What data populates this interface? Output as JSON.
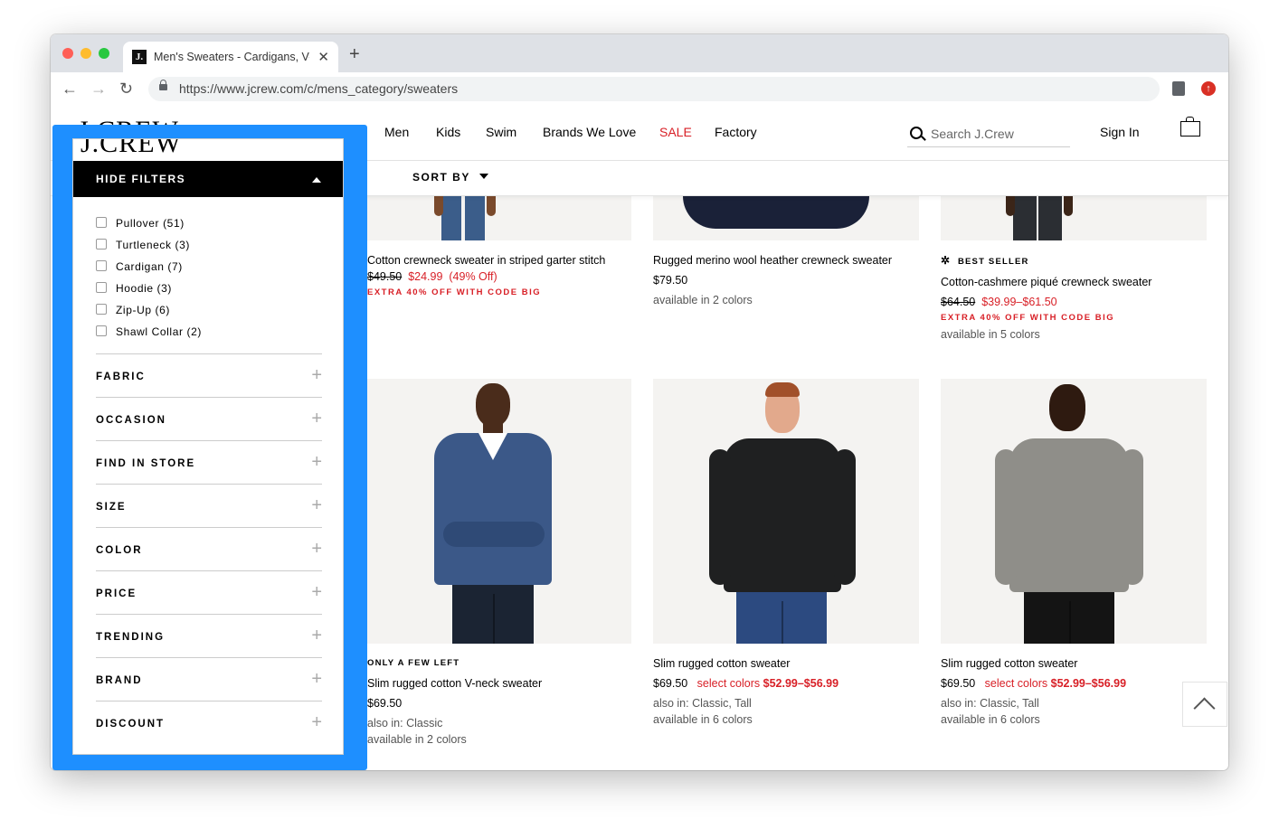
{
  "browser": {
    "tab_title": "Men's Sweaters - Cardigans, V-Neck",
    "favicon_text": "J.",
    "url": "https://www.jcrew.com/c/mens_category/sweaters"
  },
  "header": {
    "logo": "J.CREW",
    "nav": [
      "Men",
      "Kids",
      "Swim",
      "Brands We Love",
      "SALE",
      "Factory"
    ],
    "search_placeholder": "Search J.Crew",
    "sign_in": "Sign In"
  },
  "sort_label": "SORT BY",
  "filters": {
    "hide_label": "HIDE FILTERS",
    "types": [
      "Pullover (51)",
      "Turtleneck (3)",
      "Cardigan (7)",
      "Hoodie (3)",
      "Zip-Up (6)",
      "Shawl Collar (2)"
    ],
    "sections": [
      "FABRIC",
      "OCCASION",
      "FIND IN STORE",
      "SIZE",
      "COLOR",
      "PRICE",
      "TRENDING",
      "BRAND",
      "DISCOUNT"
    ]
  },
  "products_top": [
    {
      "name": "Cotton crewneck sweater in striped garter stitch",
      "price_orig": "$49.50",
      "price_sale": "$24.99",
      "pct": "(49% Off)",
      "promo": "EXTRA 40% OFF WITH CODE BIG"
    },
    {
      "name": "Rugged merino wool heather crewneck sweater",
      "price": "$79.50",
      "colors": "available in 2 colors"
    },
    {
      "badge": "BEST SELLER",
      "name": "Cotton-cashmere piqué crewneck sweater",
      "price_orig": "$64.50",
      "price_sale": "$39.99–$61.50",
      "promo": "EXTRA 40% OFF WITH CODE BIG",
      "colors": "available in 5 colors"
    }
  ],
  "products_bottom": [
    {
      "badge": "ONLY A FEW LEFT",
      "name": "Slim rugged cotton V-neck sweater",
      "price": "$69.50",
      "also": "also in: Classic",
      "colors": "available in 2 colors"
    },
    {
      "name": "Slim rugged cotton sweater",
      "price": "$69.50",
      "select_label": "select colors",
      "select_price": "$52.99–$56.99",
      "also": "also in: Classic, Tall",
      "colors": "available in 6 colors"
    },
    {
      "name": "Slim rugged cotton sweater",
      "price": "$69.50",
      "select_label": "select colors",
      "select_price": "$52.99–$56.99",
      "also": "also in: Classic, Tall",
      "colors": "available in 6 colors"
    }
  ],
  "colors": {
    "accent_sale": "#d81f26",
    "highlight_border": "#1e8fff"
  }
}
